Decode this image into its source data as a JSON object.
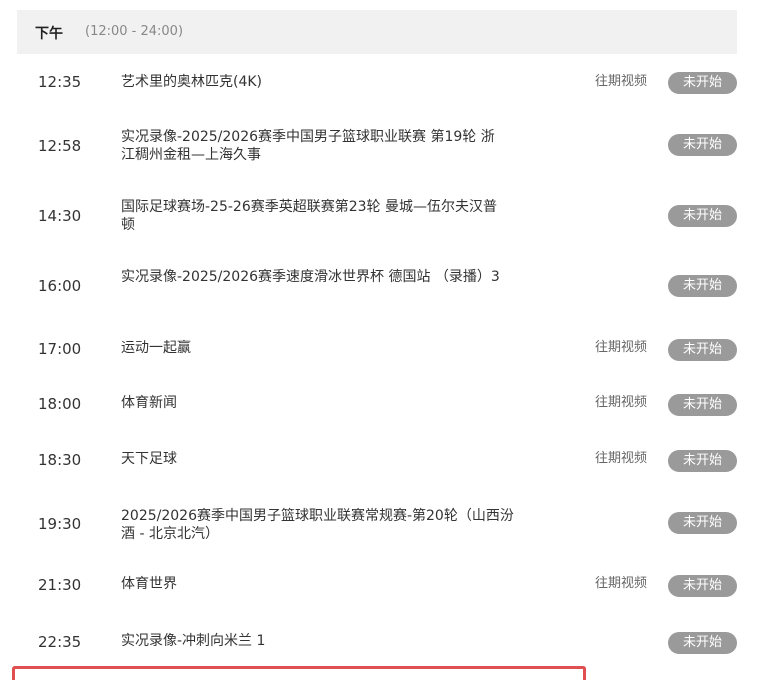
{
  "section": {
    "label": "下午",
    "range": "(12:00 - 24:00)"
  },
  "programs": [
    {
      "time": "12:35",
      "title": "艺术里的奥林匹克(4K)",
      "replay": "往期视频",
      "status": "未开始"
    },
    {
      "time": "12:58",
      "title": "实况录像-2025/2026赛季中国男子篮球职业联赛 第19轮 浙江稠州金租—上海久事",
      "replay": "",
      "status": "未开始"
    },
    {
      "time": "14:30",
      "title": "国际足球赛场-25-26赛季英超联赛第23轮 曼城—伍尔夫汉普顿",
      "replay": "",
      "status": "未开始"
    },
    {
      "time": "16:00",
      "title": "实况录像-2025/2026赛季速度滑冰世界杯 德国站 （录播）3",
      "replay": "",
      "status": "未开始"
    },
    {
      "time": "17:00",
      "title": "运动一起赢",
      "replay": "往期视频",
      "status": "未开始"
    },
    {
      "time": "18:00",
      "title": "体育新闻",
      "replay": "往期视频",
      "status": "未开始"
    },
    {
      "time": "18:30",
      "title": "天下足球",
      "replay": "往期视频",
      "status": "未开始"
    },
    {
      "time": "19:30",
      "title": "2025/2026赛季中国男子篮球职业联赛常规赛-第20轮（山西汾酒 - 北京北汽）",
      "replay": "",
      "status": "未开始"
    },
    {
      "time": "21:30",
      "title": "体育世界",
      "replay": "往期视频",
      "status": "未开始"
    },
    {
      "time": "22:35",
      "title": "实况录像-冲刺向米兰 1",
      "replay": "",
      "status": "未开始"
    }
  ]
}
